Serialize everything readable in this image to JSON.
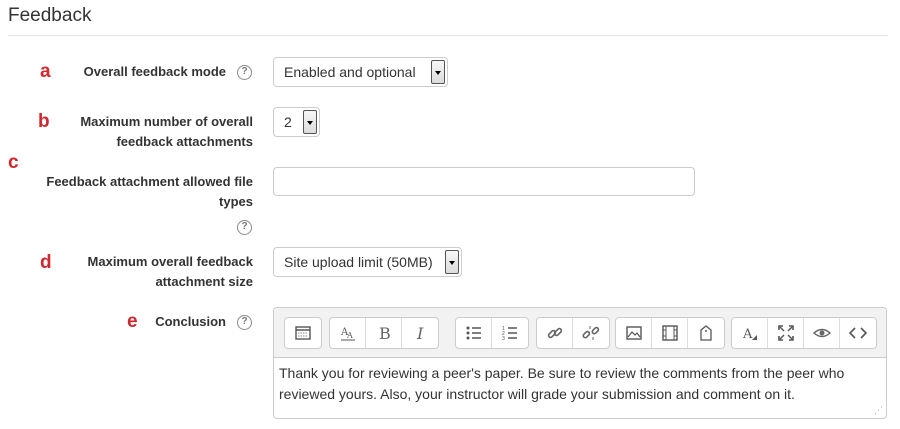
{
  "section": {
    "title": "Feedback"
  },
  "fields": {
    "feedback_mode": {
      "marker": "a",
      "label": "Overall feedback mode",
      "value": "Enabled and optional"
    },
    "max_attachments": {
      "marker": "b",
      "label_line1": "Maximum number of overall",
      "label_line2": "feedback attachments",
      "value": "2"
    },
    "file_types": {
      "marker": "c",
      "label_line1": "Feedback attachment allowed file",
      "label_line2": "types",
      "value": ""
    },
    "max_size": {
      "marker": "d",
      "label_line1": "Maximum overall feedback",
      "label_line2": "attachment size",
      "value": "Site upload limit (50MB)"
    },
    "conclusion": {
      "marker": "e",
      "label": "Conclusion",
      "text": "Thank you for reviewing a peer's paper.  Be sure to review the comments from the peer who reviewed yours.  Also, your instructor will grade your submission and comment on it."
    }
  },
  "help_icon": {
    "glyph": "?"
  },
  "toolbar_icons": [
    "show-more-icon",
    "font-style-icon",
    "bold-icon",
    "italic-icon",
    "unordered-list-icon",
    "ordered-list-icon",
    "link-icon",
    "unlink-icon",
    "image-icon",
    "media-icon",
    "manage-files-icon",
    "clear-formatting-icon",
    "fullscreen-icon",
    "preview-icon",
    "html-source-icon"
  ],
  "colors": {
    "marker": "#d0282e",
    "label": "#333333",
    "border": "#cccccc"
  }
}
